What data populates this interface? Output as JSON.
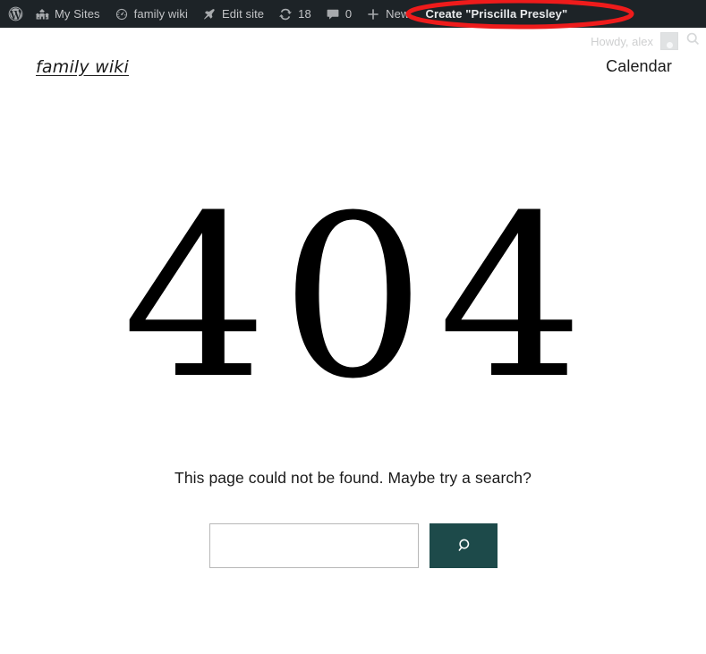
{
  "admin_bar": {
    "background_color": "#1d2327",
    "text_color": "#c3c4c7",
    "items": [
      {
        "name": "wp-logo",
        "label": "",
        "icon": "wordpress-icon"
      },
      {
        "name": "my-sites",
        "label": "My Sites",
        "icon": "buildings-icon"
      },
      {
        "name": "site-name",
        "label": "family wiki",
        "icon": "dashboard-gauge-icon"
      },
      {
        "name": "edit-site",
        "label": "Edit site",
        "icon": "pencil-pin-icon"
      },
      {
        "name": "updates",
        "label": "18",
        "icon": "update-refresh-icon"
      },
      {
        "name": "comments",
        "label": "0",
        "icon": "comment-bubble-icon"
      },
      {
        "name": "new-content",
        "label": "New",
        "icon": "plus-icon"
      },
      {
        "name": "create-entity",
        "label": "Create \"Priscilla Presley\"",
        "icon": ""
      }
    ],
    "account": {
      "howdy": "Howdy, alex",
      "avatar_alt": "alex",
      "search_icon": "search-icon"
    }
  },
  "annotation": {
    "type": "ellipse",
    "color": "#ee1b1b",
    "targets": "create-entity"
  },
  "site_header": {
    "title": "family wiki",
    "nav": [
      {
        "label": "Calendar"
      }
    ]
  },
  "main": {
    "error_code": "404",
    "message": "This page could not be found. Maybe try a search?",
    "search": {
      "value": "",
      "placeholder": "",
      "submit_icon": "search-icon",
      "submit_label": "Search",
      "button_color": "#1d4a4a"
    }
  }
}
